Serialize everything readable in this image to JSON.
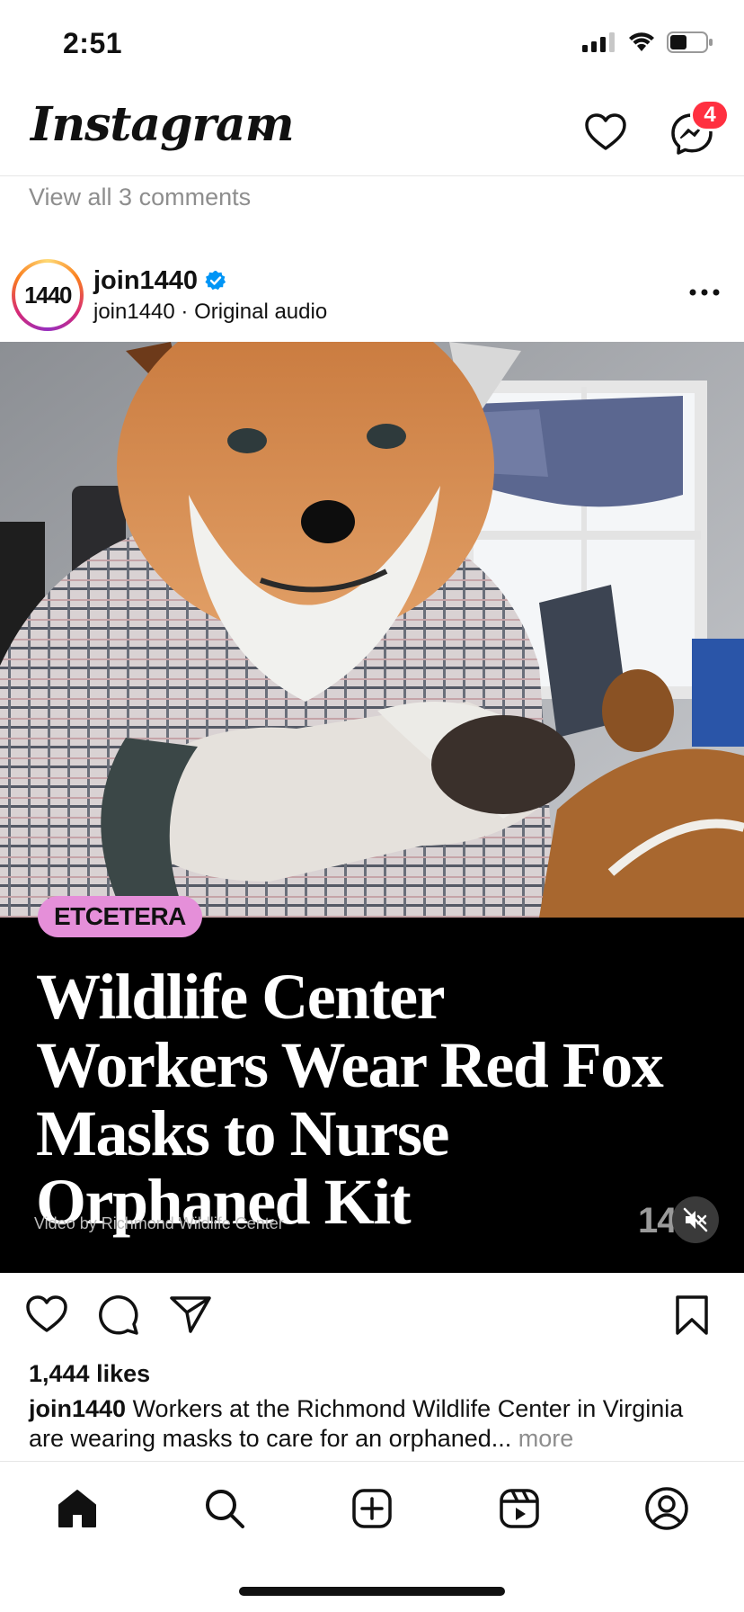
{
  "status_bar": {
    "time": "2:51"
  },
  "header": {
    "logo": "Instagram",
    "messages_badge": "4"
  },
  "feed": {
    "view_comments": "View all 3 comments"
  },
  "post": {
    "username": "join1440",
    "avatar_text": "1440",
    "subtitle": "join1440 · Original audio",
    "tag": "ETCETERA",
    "headline": "Wildlife Center Workers Wear Red Fox Masks to Nurse Orphaned Kit",
    "credit": "Video by Richmond Wildlife Center",
    "counter": "14",
    "likes": "1,444 likes",
    "caption_user": "join1440",
    "caption_text": " Workers at the Richmond Wildlife Center in Virginia are wearing masks to care for an orphaned...",
    "caption_more": " more"
  },
  "colors": {
    "badge": "#ff3040",
    "tag_pill": "#e58fd9",
    "verified": "#0095f6"
  }
}
